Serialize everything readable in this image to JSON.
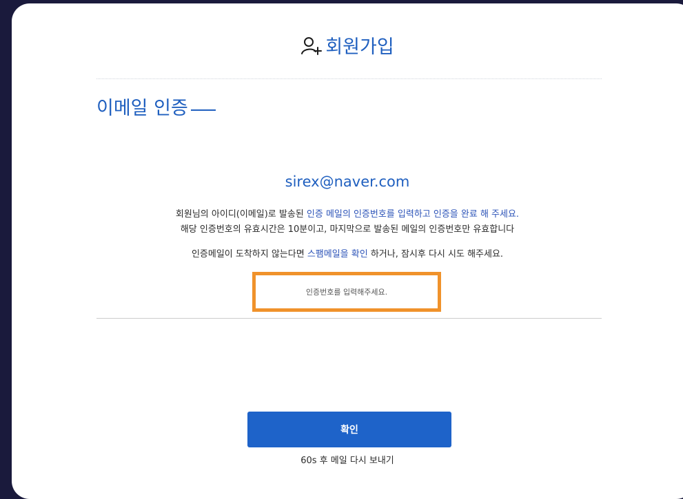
{
  "header": {
    "icon": "user-add-icon",
    "title": "회원가입"
  },
  "section": {
    "title": "이메일 인증"
  },
  "email": "sirex@naver.com",
  "instructions": {
    "line1_a": "회원님의 아이디(이메일)로 발송된 ",
    "line1_b": "인증 메일의 인증번호를 입력하고 인증을 완료",
    "line1_c": " 해 주세요.",
    "line2": "해당 인증번호의 유효시간은 10분이고, 마지막으로 발송된 메일의 인증번호만 유효합니다",
    "line3_a": "인증메일이 도착하지 않는다면 ",
    "line3_b": "스팸메일을 확인",
    "line3_c": " 하거나, 잠시후 다시 시도 해주세요."
  },
  "code_input": {
    "value": "",
    "placeholder": "인증번호를 입력해주세요."
  },
  "confirm_button": {
    "label": "확인"
  },
  "resend_link": {
    "label": "60s 후 메일 다시 보내기"
  },
  "colors": {
    "accent": "#1f5fbf",
    "button": "#1e63c9",
    "highlight_border": "#f0922b",
    "backdrop": "#1a1a3c"
  }
}
